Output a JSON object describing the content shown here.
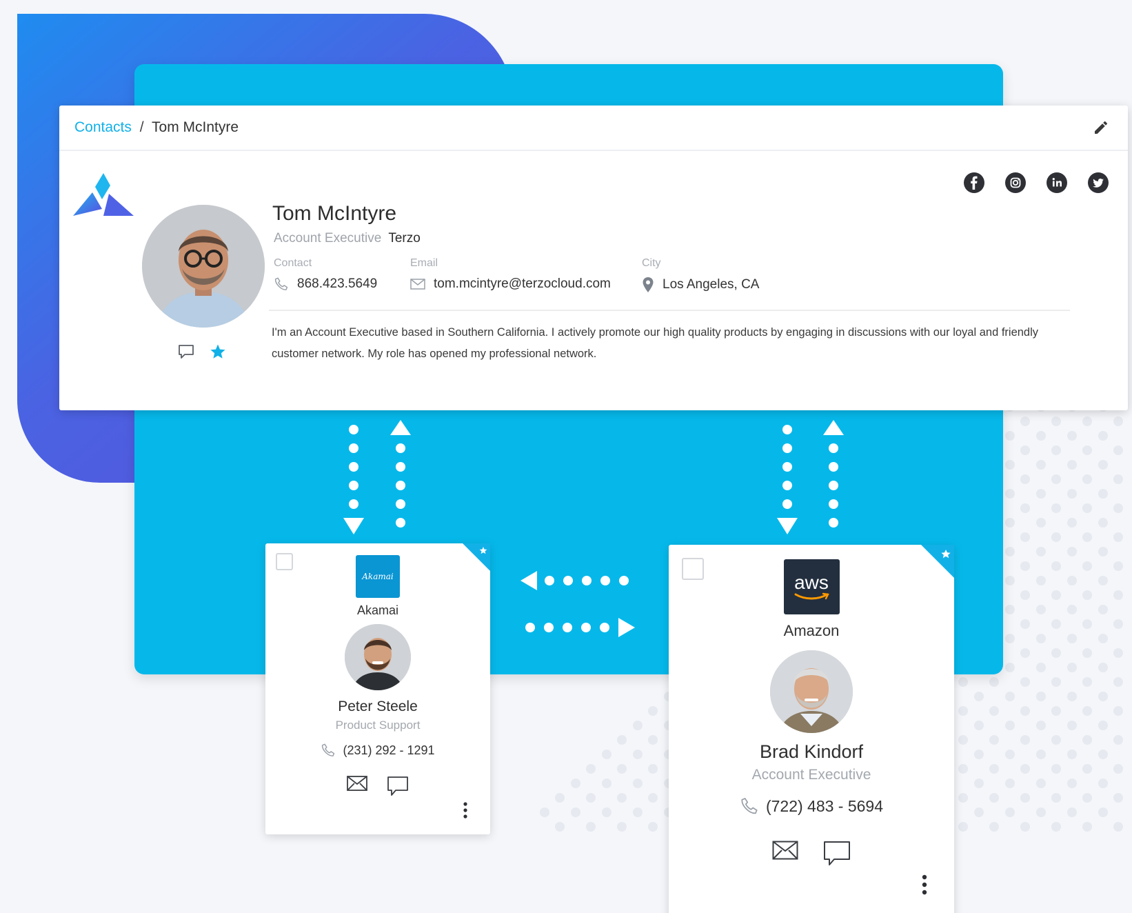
{
  "breadcrumb": {
    "parent": "Contacts",
    "separator": "/",
    "current": "Tom McIntyre"
  },
  "icons": {
    "edit": "pencil-icon",
    "logo": "terzo-logo",
    "message": "message-icon",
    "favorite": "star-icon",
    "phone": "phone-icon",
    "email": "envelope-icon",
    "city": "location-pin-icon",
    "more": "more-vertical-icon"
  },
  "colors": {
    "accent": "#11b1e8",
    "panel": "#06b8ea",
    "blob_start": "#1f8cf0",
    "blob_end": "#5b4fd8",
    "akamai": "#0a95d3",
    "aws": "#232f3e"
  },
  "profile": {
    "name": "Tom McIntyre",
    "role": "Account Executive",
    "company": "Terzo",
    "contact_label": "Contact",
    "phone": "868.423.5649",
    "email_label": "Email",
    "email": "tom.mcintyre@terzocloud.com",
    "city_label": "City",
    "city": "Los Angeles, CA",
    "bio": "I'm an Account Executive based in Southern California. I actively promote our high quality products by engaging in discussions with our loyal and friendly customer network. My role has opened my professional network."
  },
  "socials": [
    "facebook-icon",
    "instagram-icon",
    "linkedin-icon",
    "twitter-icon"
  ],
  "contacts": [
    {
      "company": "Akamai",
      "logo_text": "Akamai",
      "name": "Peter Steele",
      "role": "Product Support",
      "phone": "(231) 292 - 1291"
    },
    {
      "company": "Amazon",
      "logo_text": "aws",
      "name": "Brad Kindorf",
      "role": "Account Executive",
      "phone": "(722) 483 - 5694"
    }
  ]
}
